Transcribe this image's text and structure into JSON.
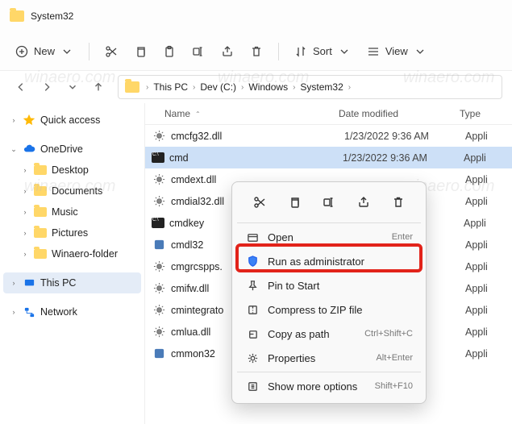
{
  "title": "System32",
  "toolbar": {
    "new": "New",
    "sort": "Sort",
    "view": "View"
  },
  "breadcrumbs": [
    "This PC",
    "Dev (C:)",
    "Windows",
    "System32"
  ],
  "sidebar": {
    "quick_access": "Quick access",
    "onedrive": "OneDrive",
    "desktop": "Desktop",
    "documents": "Documents",
    "music": "Music",
    "pictures": "Pictures",
    "winaero": "Winaero-folder",
    "this_pc": "This PC",
    "network": "Network"
  },
  "columns": {
    "name": "Name",
    "date": "Date modified",
    "type": "Type"
  },
  "files": [
    {
      "name": "cmcfg32.dll",
      "date": "1/23/2022 9:36 AM",
      "type": "Appli"
    },
    {
      "name": "cmd",
      "date": "1/23/2022 9:36 AM",
      "type": "Appli"
    },
    {
      "name": "cmdext.dll",
      "date": "",
      "type": "Appli"
    },
    {
      "name": "cmdial32.dll",
      "date": "",
      "type": "Appli"
    },
    {
      "name": "cmdkey",
      "date": "",
      "type": "Appli"
    },
    {
      "name": "cmdl32",
      "date": "",
      "type": "Appli"
    },
    {
      "name": "cmgrcspps.",
      "date": "",
      "type": "Appli"
    },
    {
      "name": "cmifw.dll",
      "date": "",
      "type": "Appli"
    },
    {
      "name": "cmintegrato",
      "date": "",
      "type": "Appli"
    },
    {
      "name": "cmlua.dll",
      "date": "",
      "type": "Appli"
    },
    {
      "name": "cmmon32",
      "date": "",
      "type": "Appli"
    }
  ],
  "context_menu": {
    "open": "Open",
    "open_accel": "Enter",
    "run_admin": "Run as administrator",
    "pin_start": "Pin to Start",
    "compress": "Compress to ZIP file",
    "copy_path": "Copy as path",
    "copy_path_accel": "Ctrl+Shift+C",
    "properties": "Properties",
    "properties_accel": "Alt+Enter",
    "more": "Show more options",
    "more_accel": "Shift+F10"
  },
  "watermark": "winaero.com"
}
